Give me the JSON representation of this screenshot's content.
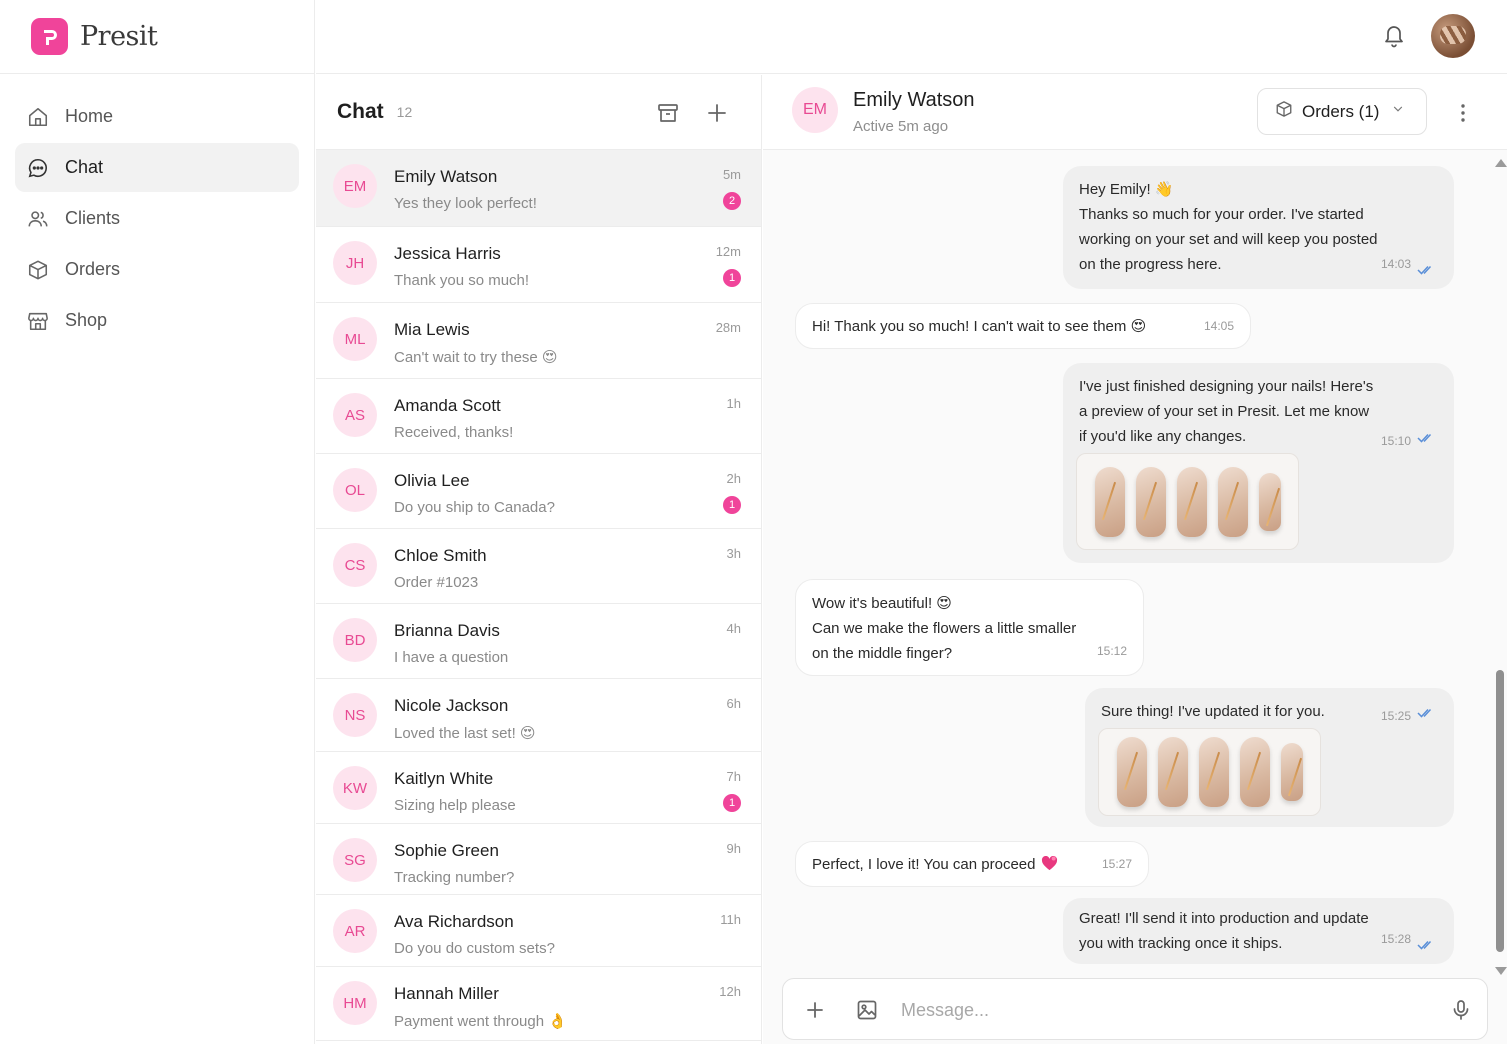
{
  "brand": {
    "name": "Presit",
    "accent": "#f0449a"
  },
  "sidebar": {
    "items": [
      {
        "label": "Home",
        "icon": "home-icon"
      },
      {
        "label": "Chat",
        "icon": "chat-icon"
      },
      {
        "label": "Clients",
        "icon": "users-icon"
      },
      {
        "label": "Orders",
        "icon": "box-icon"
      },
      {
        "label": "Shop",
        "icon": "store-icon"
      }
    ],
    "active": "Chat"
  },
  "topbar": {
    "notification_icon": "bell-icon"
  },
  "chatlist": {
    "title": "Chat",
    "count": "12",
    "conversations": [
      {
        "initials": "EM",
        "name": "Emily Watson",
        "preview": "Yes they look perfect!",
        "time": "5m",
        "badge": "2"
      },
      {
        "initials": "JH",
        "name": "Jessica Harris",
        "preview": "Thank you so much!",
        "time": "12m",
        "badge": "1"
      },
      {
        "initials": "ML",
        "name": "Mia Lewis",
        "preview": "Can't wait to try these 😍",
        "time": "28m",
        "badge": ""
      },
      {
        "initials": "AS",
        "name": "Amanda Scott",
        "preview": "Received, thanks!",
        "time": "1h",
        "badge": ""
      },
      {
        "initials": "OL",
        "name": "Olivia Lee",
        "preview": "Do you ship to Canada?",
        "time": "2h",
        "badge": "1"
      },
      {
        "initials": "CS",
        "name": "Chloe Smith",
        "preview": "Order #1023",
        "time": "3h",
        "badge": ""
      },
      {
        "initials": "BD",
        "name": "Brianna Davis",
        "preview": "I have a question",
        "time": "4h",
        "badge": ""
      },
      {
        "initials": "NS",
        "name": "Nicole Jackson",
        "preview": "Loved the last set! 😍",
        "time": "6h",
        "badge": ""
      },
      {
        "initials": "KW",
        "name": "Kaitlyn White",
        "preview": "Sizing help please",
        "time": "7h",
        "badge": "1"
      },
      {
        "initials": "SG",
        "name": "Sophie Green",
        "preview": "Tracking number?",
        "time": "9h",
        "badge": ""
      },
      {
        "initials": "AR",
        "name": "Ava Richardson",
        "preview": "Do you do custom sets?",
        "time": "11h",
        "badge": ""
      },
      {
        "initials": "HM",
        "name": "Hannah Miller",
        "preview": "Payment went through 👌",
        "time": "12h",
        "badge": ""
      }
    ]
  },
  "conversation": {
    "initials": "EM",
    "name": "Emily Watson",
    "status": "Active 5m ago",
    "orders_label": "Orders (1)",
    "messages": [
      {
        "dir": "out",
        "lines": [
          "Hey Emily! 👋",
          "Thanks so much for your order. I've started",
          "working on your set and will keep you posted",
          "on the progress here."
        ],
        "time": "14:03"
      },
      {
        "dir": "in",
        "lines": [
          "Hi! Thank you so much! I can't wait to see them 😍"
        ],
        "time": "14:05"
      },
      {
        "dir": "out",
        "lines": [
          "I've just finished designing your nails! Here's",
          "a preview of your set in Presit. Let me know",
          "if you'd like any changes."
        ],
        "time": "15:10",
        "image": "nail-preview"
      },
      {
        "dir": "in",
        "lines": [
          "Wow it's beautiful! 😍",
          "Can we make the flowers a little smaller",
          "on the middle finger?"
        ],
        "time": "15:12"
      },
      {
        "dir": "out",
        "lines": [
          "Sure thing! I've updated it for you."
        ],
        "time": "15:25",
        "image": "nail-preview"
      },
      {
        "dir": "in",
        "lines": [
          "Perfect, I love it! You can proceed"
        ],
        "time": "15:27",
        "emoji": "heart"
      },
      {
        "dir": "out",
        "lines": [
          "Great! I'll send it into production and update",
          "you with tracking once it ships."
        ],
        "time": "15:28"
      }
    ]
  },
  "composer": {
    "placeholder": "Message..."
  }
}
